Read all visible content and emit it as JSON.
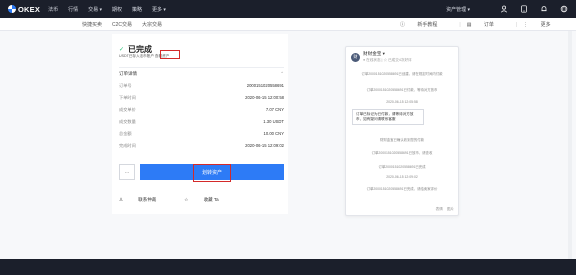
{
  "topnav": {
    "logo": "OKEX",
    "items": [
      "法币",
      "行情",
      "交易 ▾",
      "期权",
      "策略",
      "更多 ▾"
    ],
    "assets": "资产管理 ▾"
  },
  "subnav": {
    "left": [
      "快捷买卖",
      "C2C交易",
      "大宗交易"
    ],
    "right": [
      "新手教程",
      "订单",
      "更多"
    ]
  },
  "status": {
    "title": "已完成",
    "subtitle": "USDT已存入法币账户 查看资产"
  },
  "order": {
    "header": "订单详情",
    "rows": [
      {
        "k": "订单号",
        "v": "2000151020558691"
      },
      {
        "k": "下单时间",
        "v": "2020-06-15 12:00:58"
      },
      {
        "k": "成交单价",
        "v": "7.07 CNY"
      },
      {
        "k": "成交数量",
        "v": "1.30 USDT"
      },
      {
        "k": "总金额",
        "v": "10.00 CNY"
      },
      {
        "k": "完成时间",
        "v": "2020-06-15 12:09:02"
      }
    ]
  },
  "buttons": {
    "side": "…",
    "primary": "划转资产"
  },
  "links": {
    "contact": "联系仲裁",
    "favorite": "收藏 Ta"
  },
  "chat": {
    "avatar": "财",
    "name": "财财金宝 ▾",
    "status": "● 在线状态 | ☆ 已成交4次好评",
    "messages": [
      "订单2000151020558691已创建，请在规定时间内付款",
      "订单2000151020558691已付款，等待对方放币",
      "2020-06-15 12:05:58"
    ],
    "bubble": "订单已标记为已付款，请等待对方放币，如有疑问请联系客服",
    "messages2": [
      "财财金宝已确认收到您的付款",
      "订单2000151020558691已放币，请查收",
      "订单2000151020558691已完成",
      "2020-06-15 12:09:02",
      "订单2000151020558691已完成，请给卖家评价"
    ],
    "footer": [
      "表情",
      "图片"
    ]
  },
  "colors": {
    "accent": "#2d7bf6",
    "success": "#2cc27a",
    "highlight": "#d42a2a",
    "nav_bg": "#1b1f2b"
  }
}
